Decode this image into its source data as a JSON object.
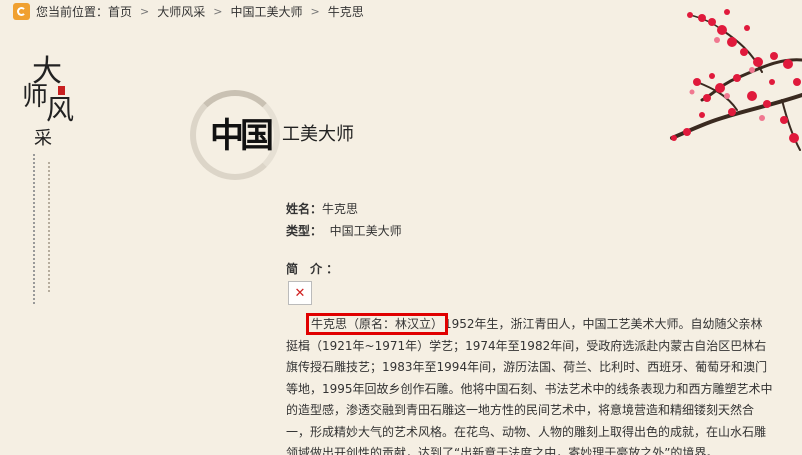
{
  "breadcrumb": {
    "prefix": "您当前位置：",
    "items": [
      {
        "label": "首页"
      },
      {
        "label": "大师风采"
      },
      {
        "label": "中国工美大师"
      }
    ],
    "current": "牛克思"
  },
  "side_title": {
    "chars": [
      "大",
      "师",
      "风",
      "采"
    ]
  },
  "header": {
    "calligraphy": "中国",
    "subtitle": "工美大师"
  },
  "profile": {
    "name_label": "姓名：",
    "name_value": "牛克思",
    "type_label": "类型：",
    "type_value": "中国工美大师",
    "intro_label": "简  介："
  },
  "bio": {
    "highlight": "牛克思（原名：林汉立）",
    "text": "1952年生，浙江青田人，中国工艺美术大师。自幼随父亲林挺楫（1921年~1971年）学艺；1974年至1982年间，受政府选派赴内蒙古自治区巴林右旗传授石雕技艺；1983年至1994年间，游历法国、荷兰、比利时、西班牙、葡萄牙和澳门等地，1995年回故乡创作石雕。他将中国石刻、书法艺术中的线条表现力和西方雕塑艺术中的造型感，渗透交融到青田石雕这一地方性的民间艺术中，将意境营造和精细镂刻天然合一，形成精妙大气的艺术风格。在花鸟、动物、人物的雕刻上取得出色的成就，在山水石雕领域做出开创性的贡献，达到了“出新意于法度之中，寄妙理于豪放之外”的境界。"
  },
  "colors": {
    "background": "#f5efe3",
    "highlight_border": "#e00000",
    "blossom": "#e01a3c"
  }
}
